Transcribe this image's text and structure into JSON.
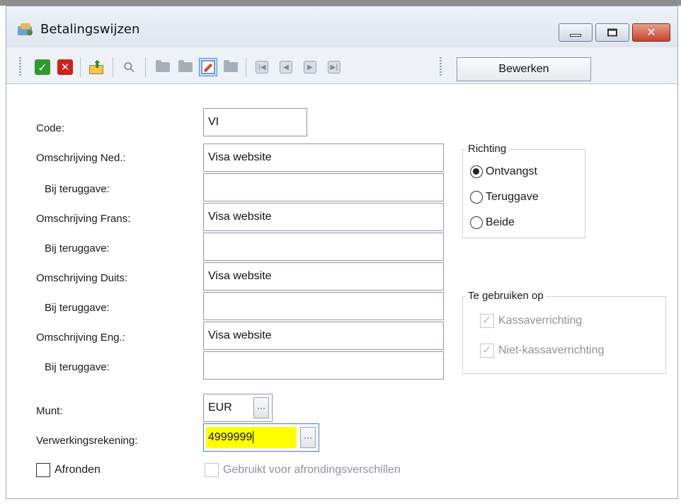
{
  "window": {
    "title": "Betalingswijzen"
  },
  "toolbar": {
    "mode_button": "Bewerken",
    "icons": [
      "check-icon",
      "cancel-icon",
      "export-icon",
      "search-icon",
      "folder-icon",
      "copy-folder-icon",
      "edit-icon",
      "folder-closed-icon",
      "first-icon",
      "prev-icon",
      "next-icon",
      "last-icon"
    ]
  },
  "form": {
    "code": {
      "label": "Code:",
      "value": "VI"
    },
    "omschrijving_ned": {
      "label": "Omschrijving Ned.:",
      "value": "Visa website"
    },
    "ned_teruggave": {
      "label": "Bij teruggave:",
      "value": ""
    },
    "omschrijving_frans": {
      "label": "Omschrijving Frans:",
      "value": "Visa website"
    },
    "frans_teruggave": {
      "label": "Bij teruggave:",
      "value": ""
    },
    "omschrijving_duits": {
      "label": "Omschrijving Duits:",
      "value": "Visa website"
    },
    "duits_teruggave": {
      "label": "Bij teruggave:",
      "value": ""
    },
    "omschrijving_eng": {
      "label": "Omschrijving Eng.:",
      "value": "Visa website"
    },
    "eng_teruggave": {
      "label": "Bij teruggave:",
      "value": ""
    },
    "munt": {
      "label": "Munt:",
      "value": "EUR",
      "button": "···"
    },
    "verwerkingsrekening": {
      "label": "Verwerkingsrekening:",
      "value": "4999999",
      "button": "···",
      "highlight": "#ffff00"
    },
    "afronden": {
      "label": "Afronden",
      "checked": false
    },
    "afrondingsverschillen": {
      "label": "Gebruikt voor afrondingsverschillen",
      "checked": false,
      "disabled": true
    }
  },
  "richting": {
    "title": "Richting",
    "options": [
      {
        "label": "Ontvangst",
        "selected": true
      },
      {
        "label": "Teruggave",
        "selected": false
      },
      {
        "label": "Beide",
        "selected": false
      }
    ]
  },
  "te_gebruiken": {
    "title": "Te gebruiken op",
    "options": [
      {
        "label": "Kassaverrichting",
        "checked": true,
        "disabled": true
      },
      {
        "label": "Niet-kassaverrichting",
        "checked": true,
        "disabled": true
      }
    ]
  }
}
